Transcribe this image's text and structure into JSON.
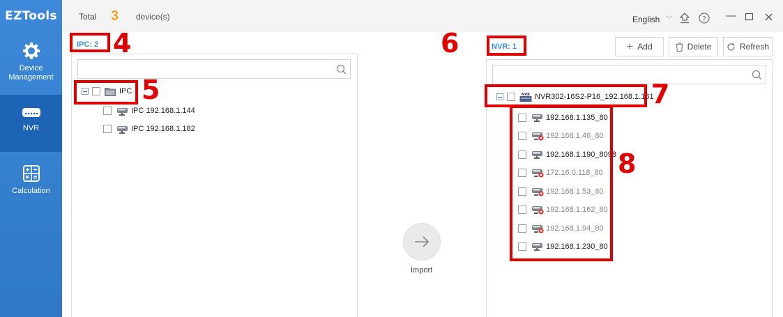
{
  "app": {
    "title": "EZTools"
  },
  "sidebar": {
    "items": [
      {
        "label": "Device\nManagement",
        "icon": "gear-icon",
        "active": false
      },
      {
        "label": "NVR",
        "icon": "nvr-device-icon",
        "active": true
      },
      {
        "label": "Calculation",
        "icon": "calculator-icon",
        "active": false
      }
    ]
  },
  "header": {
    "total_label": "Total",
    "total_count": "3",
    "devices_label": "device(s)",
    "language": "English"
  },
  "ipc_panel": {
    "count_label": "IPC: 2",
    "search_placeholder": "",
    "group_label": "IPC",
    "devices": [
      "IPC 192.168.1.144",
      "IPC 192.168.1.182"
    ]
  },
  "nvr_panel": {
    "count_label": "NVR: 1",
    "search_placeholder": "",
    "nvr_name": "NVR302-16S2-P16_192.168.1.161",
    "channels": [
      {
        "label": "192.168.1.135_80",
        "online": true
      },
      {
        "label": "192.168.1.46_80",
        "online": false
      },
      {
        "label": "192.168.1.190_8098",
        "online": true
      },
      {
        "label": "172.16.0.118_80",
        "online": false
      },
      {
        "label": "192.168.1.53_80",
        "online": false
      },
      {
        "label": "192.168.1.162_80",
        "online": false
      },
      {
        "label": "192.168.1.94_80",
        "online": false
      },
      {
        "label": "192.168.1.230_80",
        "online": true
      }
    ]
  },
  "toolbar": {
    "add_label": "Add",
    "delete_label": "Delete",
    "refresh_label": "Refresh"
  },
  "import": {
    "label": "Import"
  },
  "annotations": {
    "n4": "4",
    "n5": "5",
    "n6": "6",
    "n7": "7",
    "n8": "8"
  },
  "colors": {
    "sidebar": "#3d88d8",
    "sidebar_active": "#1d63b6",
    "accent": "#3b8ee6",
    "count_highlight": "#f5a623",
    "annotation": "#e00000"
  }
}
